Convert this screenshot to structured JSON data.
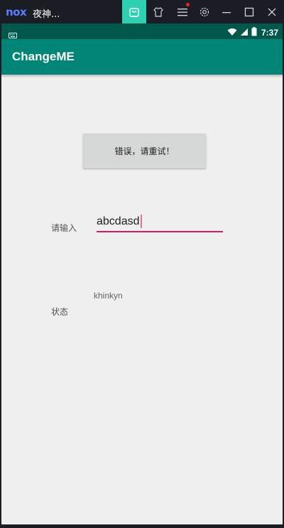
{
  "emulator": {
    "logo": "nox",
    "title": "夜神...",
    "accent": "#2fd0b2",
    "icons": [
      "bag-icon",
      "shirt-icon",
      "menu-icon",
      "gear-icon",
      "minimize-icon",
      "maximize-icon",
      "close-icon"
    ]
  },
  "statusbar": {
    "time": "7:37",
    "icons": [
      "keyboard-icon",
      "wifi-icon",
      "signal-icon",
      "battery-icon"
    ]
  },
  "app": {
    "title": "ChangeME",
    "primary_color": "#008577",
    "accent_color": "#d81b60"
  },
  "main": {
    "retry_button_label": "错误，请重试！",
    "input_label": "请输入",
    "input_value": "abcdasd",
    "status_value": "khinkyn",
    "status_label": "状态"
  }
}
